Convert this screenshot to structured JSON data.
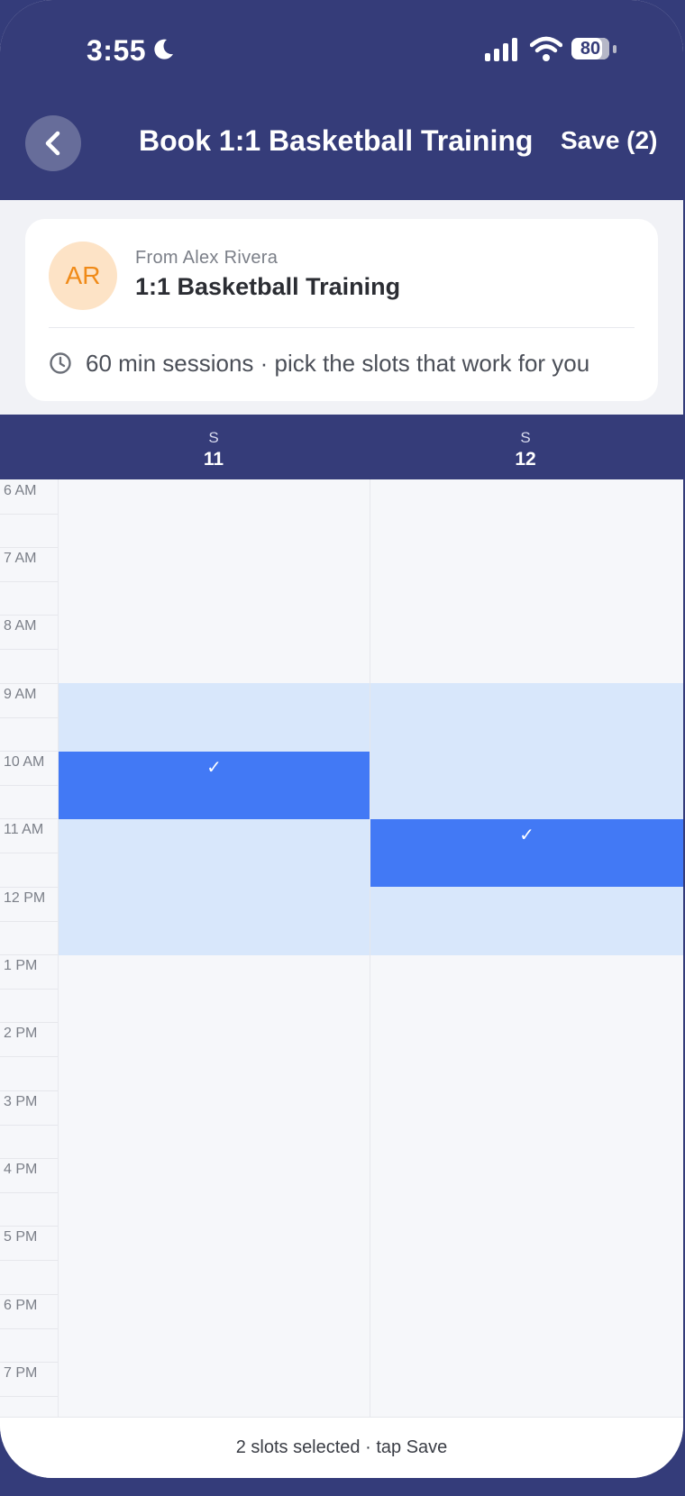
{
  "status_bar": {
    "time": "3:55",
    "battery": "80"
  },
  "header": {
    "title": "Book 1:1 Basketball Training",
    "save_label": "Save (2)"
  },
  "card": {
    "avatar_initials": "AR",
    "from": "From Alex Rivera",
    "title": "1:1 Basketball Training",
    "session_note": "60 min sessions · pick the slots that work for you"
  },
  "days": [
    {
      "dow": "S",
      "date": "11"
    },
    {
      "dow": "S",
      "date": "12"
    }
  ],
  "hours": [
    "6 AM",
    "7 AM",
    "8 AM",
    "9 AM",
    "10 AM",
    "11 AM",
    "12 PM",
    "1 PM",
    "2 PM",
    "3 PM",
    "4 PM",
    "5 PM",
    "6 PM",
    "7 PM"
  ],
  "slots": {
    "available_range": "9 AM – 1 PM",
    "selected": [
      {
        "day": "11",
        "start": "10 AM",
        "mark": "✓"
      },
      {
        "day": "12",
        "start": "11 AM",
        "mark": "✓"
      }
    ]
  },
  "footer": {
    "status": "2 slots selected · tap Save"
  },
  "colors": {
    "header_bg": "#353c79",
    "available": "#d8e7fb",
    "selected": "#4279f5",
    "avatar_bg": "#fde3c6",
    "avatar_text": "#f08a17"
  },
  "icons": {
    "back": "chevron-left-icon",
    "clock": "clock-icon",
    "moon": "moon-icon",
    "signal": "signal-icon",
    "wifi": "wifi-icon",
    "battery": "battery-icon"
  }
}
